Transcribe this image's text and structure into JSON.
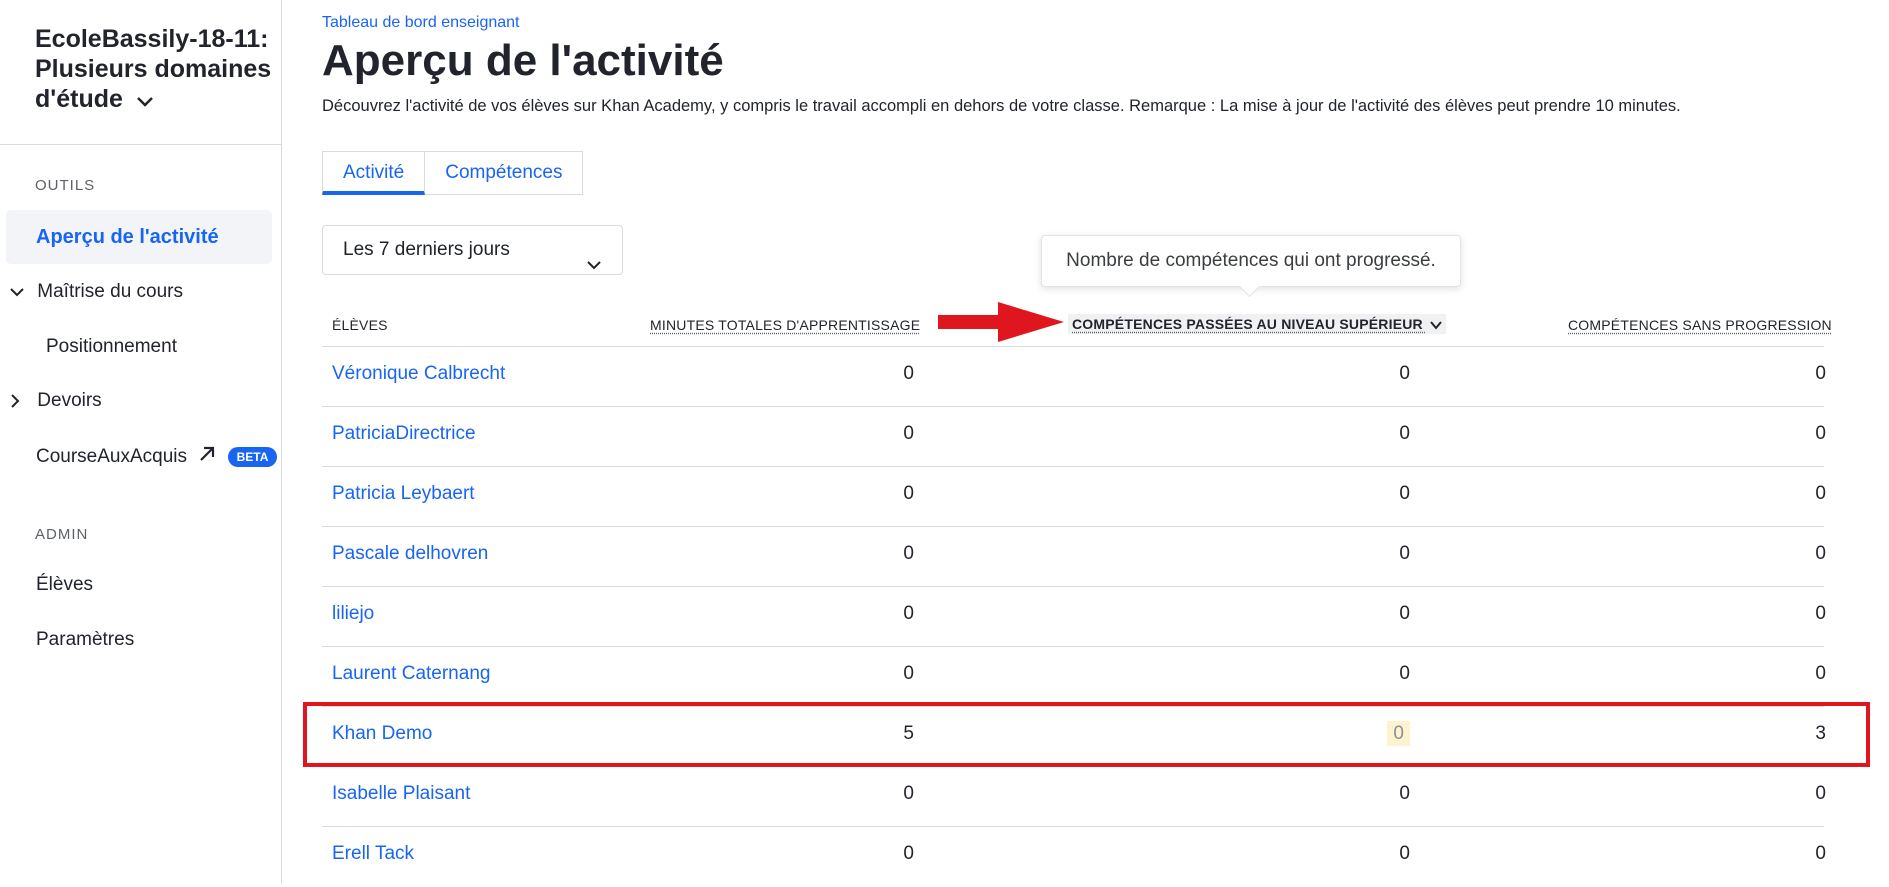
{
  "sidebar": {
    "class_title": "EcoleBassily-18-11: Plusieurs domaines d'étude",
    "tools_label": "OUTILS",
    "items": {
      "overview": "Aperçu de l'activité",
      "mastery": "Maîtrise du cours",
      "positioning": "Positionnement",
      "assignments": "Devoirs",
      "course_challenge": "CourseAuxAcquis",
      "beta_badge": "BETA"
    },
    "admin_label": "ADMIN",
    "admin_items": {
      "students": "Élèves",
      "settings": "Paramètres"
    }
  },
  "main": {
    "breadcrumb": "Tableau de bord enseignant",
    "title": "Aperçu de l'activité",
    "description": "Découvrez l'activité de vos élèves sur Khan Academy, y compris le travail accompli en dehors de votre classe. Remarque : La mise à jour de l'activité des élèves peut prendre 10 minutes.",
    "tabs": [
      "Activité",
      "Compétences"
    ],
    "active_tab": "Activité",
    "date_range": "Les 7 derniers jours",
    "tooltip": "Nombre de compétences qui ont progressé.",
    "table": {
      "headers": {
        "students": "ÉLÈVES",
        "minutes": "MINUTES TOTALES D'APPRENTISSAGE",
        "leveled_up": "COMPÉTENCES PASSÉES AU NIVEAU SUPÉRIEUR",
        "no_progress": "COMPÉTENCES SANS PROGRESSION"
      },
      "rows": [
        {
          "name": "Véronique Calbrecht",
          "minutes": "0",
          "leveled_up": "0",
          "no_progress": "0"
        },
        {
          "name": "PatriciaDirectrice",
          "minutes": "0",
          "leveled_up": "0",
          "no_progress": "0"
        },
        {
          "name": "Patricia Leybaert",
          "minutes": "0",
          "leveled_up": "0",
          "no_progress": "0"
        },
        {
          "name": "Pascale delhovren",
          "minutes": "0",
          "leveled_up": "0",
          "no_progress": "0"
        },
        {
          "name": "liliejo",
          "minutes": "0",
          "leveled_up": "0",
          "no_progress": "0"
        },
        {
          "name": "Laurent Caternang",
          "minutes": "0",
          "leveled_up": "0",
          "no_progress": "0"
        },
        {
          "name": "Khan Demo",
          "minutes": "5",
          "leveled_up": "0",
          "no_progress": "3"
        },
        {
          "name": "Isabelle Plaisant",
          "minutes": "0",
          "leveled_up": "0",
          "no_progress": "0"
        },
        {
          "name": "Erell Tack",
          "minutes": "0",
          "leveled_up": "0",
          "no_progress": "0"
        }
      ]
    }
  },
  "colors": {
    "accent": "#1865f2",
    "annotation_red": "#e0161e",
    "highlight_cell": "#fdf3cf"
  }
}
